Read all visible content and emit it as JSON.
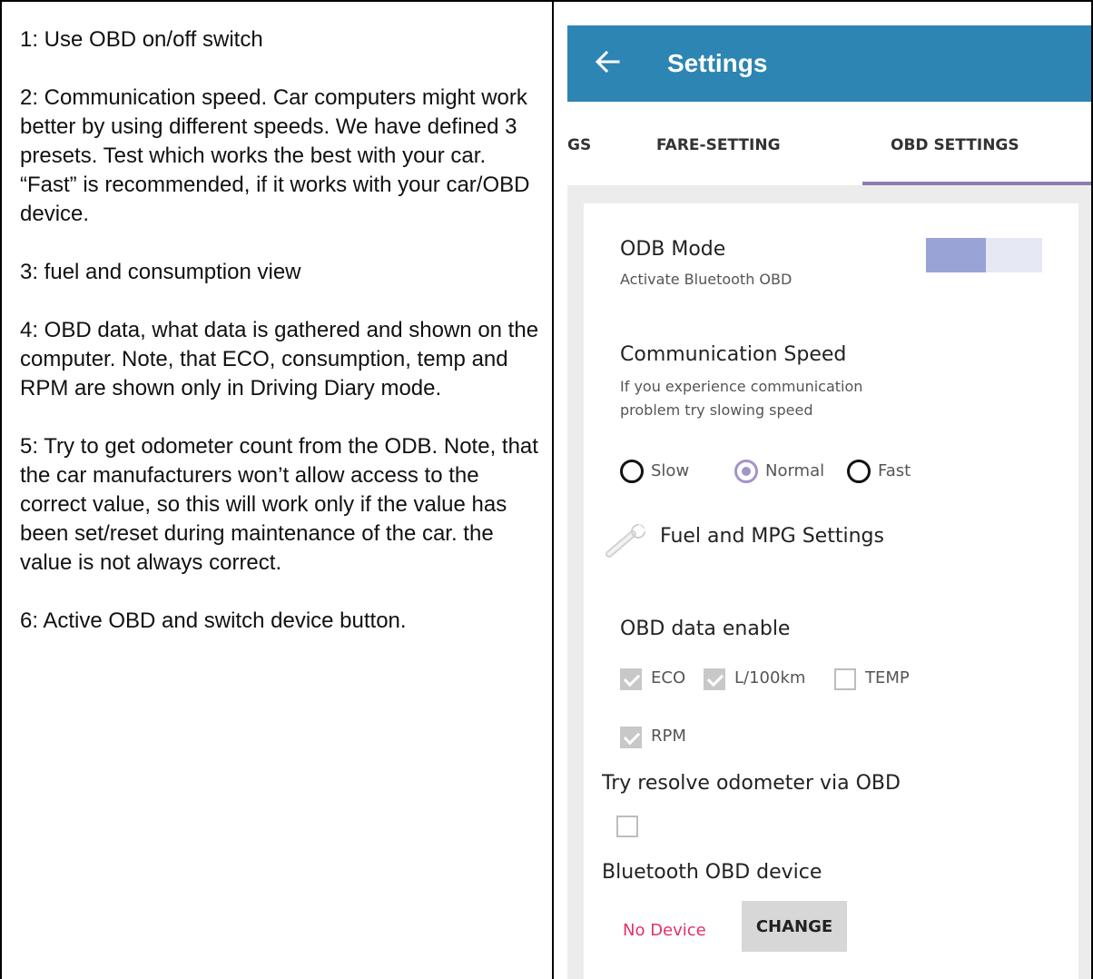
{
  "notes": [
    "1: Use OBD on/off switch",
    "2: Communication speed. Car computers might work better by using different speeds. We have defined 3 presets. Test which works the best with your car. “Fast” is recommended, if it works with your car/OBD device.",
    "3: fuel and consumption view",
    "4: OBD data, what data is gathered and shown on the computer. Note, that ECO, consumption, temp and RPM are shown only in Driving Diary mode.",
    "5: Try to get odometer count from the ODB. Note, that the car manufacturers won’t allow access to the correct value, so this will work only if the value has been set/reset during maintenance of the car. the value is not always correct.",
    "6: Active OBD and switch device button."
  ],
  "app": {
    "title": "Settings",
    "appbar_color": "#2c85b2",
    "back_icon": "arrow-left-icon",
    "tabs": [
      {
        "label": "GS",
        "active": false
      },
      {
        "label": "FARE-SETTING",
        "active": false
      },
      {
        "label": "OBD SETTINGS",
        "active": true
      }
    ],
    "obd_mode": {
      "title": "ODB Mode",
      "subtitle": "Activate Bluetooth OBD",
      "enabled": true
    },
    "comm_speed": {
      "title": "Communication Speed",
      "desc_line1": "If you experience communication",
      "desc_line2": "problem try slowing speed",
      "options": [
        "Slow",
        "Normal",
        "Fast"
      ],
      "selected": "Normal"
    },
    "fuel_settings": {
      "label": "Fuel and MPG Settings",
      "icon": "wrench-icon"
    },
    "obd_data": {
      "title": "OBD data enable",
      "items": [
        {
          "label": "ECO",
          "checked": true
        },
        {
          "label": "L/100km",
          "checked": true
        },
        {
          "label": "TEMP",
          "checked": false
        },
        {
          "label": "RPM",
          "checked": true
        }
      ]
    },
    "odometer": {
      "label": "Try resolve odometer via OBD",
      "checked": false
    },
    "bt_device": {
      "title": "Bluetooth OBD device",
      "status": "No Device",
      "status_color": "#e0306e",
      "button": "CHANGE"
    }
  }
}
